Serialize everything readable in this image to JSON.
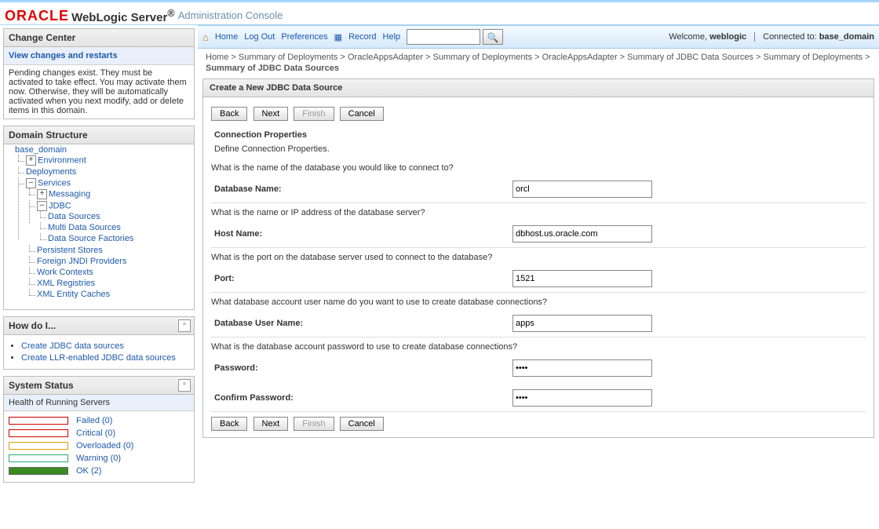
{
  "banner": {
    "oracle": "ORACLE",
    "product": "WebLogic Server",
    "reg": "®",
    "suffix": "Administration Console"
  },
  "toolbar": {
    "home": "Home",
    "logout": "Log Out",
    "prefs": "Preferences",
    "record": "Record",
    "help": "Help",
    "welcome_prefix": "Welcome, ",
    "welcome_user": "weblogic",
    "connected_prefix": "Connected to: ",
    "connected_domain": "base_domain"
  },
  "breadcrumbs": {
    "items": [
      "Home",
      "Summary of Deployments",
      "OracleAppsAdapter",
      "Summary of Deployments",
      "OracleAppsAdapter",
      "Summary of JDBC Data Sources",
      "Summary of Deployments",
      "Summary of JDBC Data Sources"
    ],
    "sep": " >"
  },
  "change_center": {
    "title": "Change Center",
    "link": "View changes and restarts",
    "msg": "Pending changes exist. They must be activated to take effect. You may activate them now. Otherwise, they will be automatically activated when you next modify, add or delete items in this domain."
  },
  "domain_structure": {
    "title": "Domain Structure",
    "root": "base_domain",
    "env": "Environment",
    "deploy": "Deployments",
    "services": "Services",
    "messaging": "Messaging",
    "jdbc": "JDBC",
    "ds": "Data Sources",
    "mds": "Multi Data Sources",
    "dsf": "Data Source Factories",
    "ps": "Persistent Stores",
    "fjp": "Foreign JNDI Providers",
    "wc": "Work Contexts",
    "xr": "XML Registries",
    "xec": "XML Entity Caches"
  },
  "howdo": {
    "title": "How do I...",
    "items": [
      "Create JDBC data sources",
      "Create LLR-enabled JDBC data sources"
    ]
  },
  "system_status": {
    "title": "System Status",
    "sub": "Health of Running Servers",
    "rows": [
      {
        "label": "Failed (0)"
      },
      {
        "label": "Critical (0)"
      },
      {
        "label": "Overloaded (0)"
      },
      {
        "label": "Warning (0)"
      },
      {
        "label": "OK (2)"
      }
    ]
  },
  "page": {
    "title": "Create a New JDBC Data Source",
    "buttons": {
      "back": "Back",
      "next": "Next",
      "finish": "Finish",
      "cancel": "Cancel"
    },
    "section_title": "Connection Properties",
    "section_sub": "Define Connection Properties.",
    "q_db": "What is the name of the database you would like to connect to?",
    "l_db": "Database Name:",
    "v_db": "orcl",
    "q_host": "What is the name or IP address of the database server?",
    "l_host": "Host Name:",
    "v_host": "dbhost.us.oracle.com",
    "q_port": "What is the port on the database server used to connect to the database?",
    "l_port": "Port:",
    "v_port": "1521",
    "q_user": "What database account user name do you want to use to create database connections?",
    "l_user": "Database User Name:",
    "v_user": "apps",
    "q_pw": "What is the database account password to use to create database connections?",
    "l_pw": "Password:",
    "v_pw": "****",
    "l_cpw": "Confirm Password:",
    "v_cpw": "****"
  }
}
